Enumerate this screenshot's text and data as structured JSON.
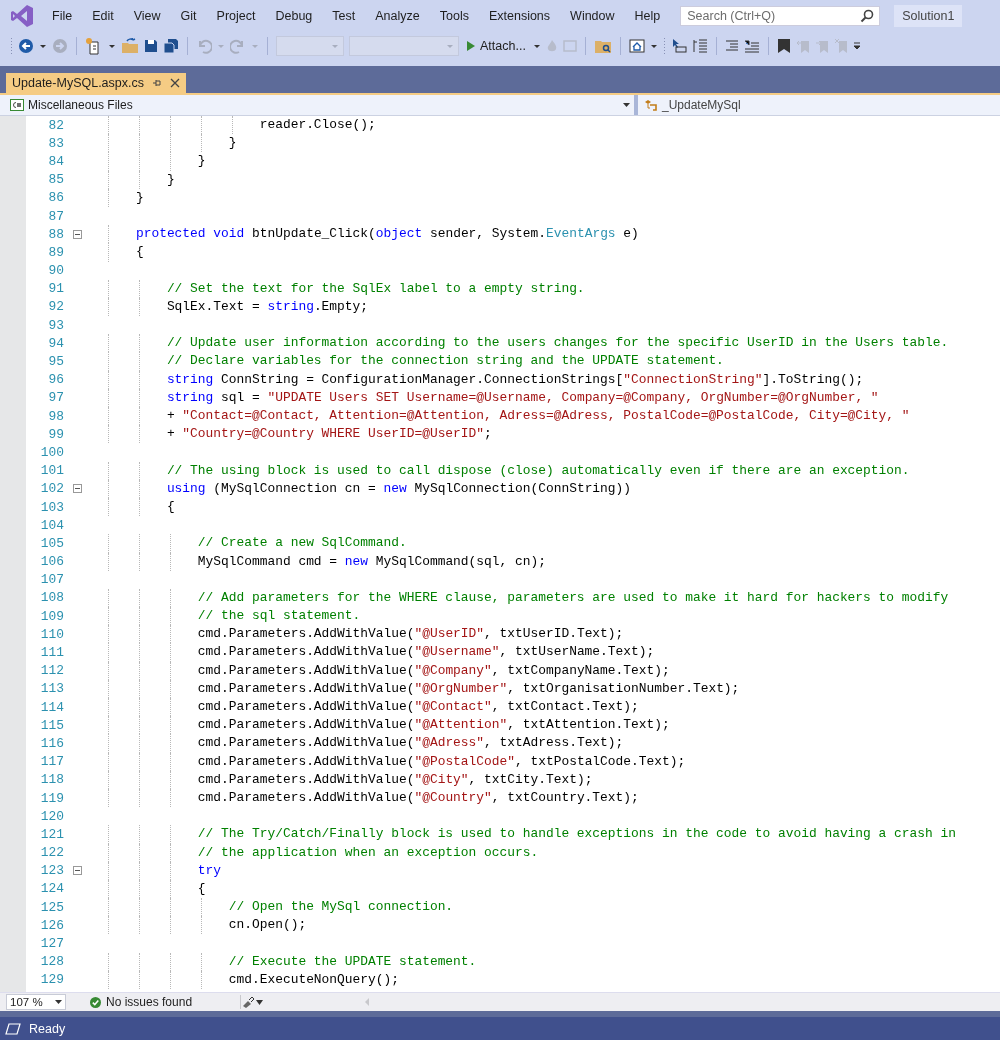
{
  "menu": {
    "items": [
      "File",
      "Edit",
      "View",
      "Git",
      "Project",
      "Debug",
      "Test",
      "Analyze",
      "Tools",
      "Extensions",
      "Window",
      "Help"
    ],
    "search": {
      "placeholder": "Search (Ctrl+Q)"
    },
    "solution": "Solution1"
  },
  "toolbar": {
    "attach": "Attach..."
  },
  "tabs": [
    {
      "label": "Update-MySQL.aspx.cs",
      "selected": true
    }
  ],
  "navbar": {
    "project": "Miscellaneous Files",
    "member": "_UpdateMySql"
  },
  "code": {
    "lines": [
      {
        "number": "82",
        "tokens": [
          {
            "kind": "plain",
            "text": "                    reader.Close();"
          }
        ]
      },
      {
        "number": "83",
        "tokens": [
          {
            "kind": "plain",
            "text": "                }"
          }
        ]
      },
      {
        "number": "84",
        "tokens": [
          {
            "kind": "plain",
            "text": "            }"
          }
        ]
      },
      {
        "number": "85",
        "tokens": [
          {
            "kind": "plain",
            "text": "        }"
          }
        ]
      },
      {
        "number": "86",
        "tokens": [
          {
            "kind": "plain",
            "text": "    }"
          }
        ]
      },
      {
        "number": "87"
      },
      {
        "number": "88",
        "expanded": true,
        "tokens": [
          {
            "kind": "keyword",
            "text": "    protected"
          },
          {
            "kind": "keyword",
            "text": " void"
          },
          {
            "kind": "plain",
            "text": " btnUpdate_Click("
          },
          {
            "kind": "keyword",
            "text": "object"
          },
          {
            "kind": "plain",
            "text": " sender, System."
          },
          {
            "kind": "type",
            "text": "EventArgs"
          },
          {
            "kind": "plain",
            "text": " e)"
          }
        ]
      },
      {
        "number": "89",
        "tokens": [
          {
            "kind": "plain",
            "text": "    {"
          }
        ]
      },
      {
        "number": "90"
      },
      {
        "number": "91",
        "tokens": [
          {
            "kind": "comment",
            "text": "        // Set the text for the SqlEx label to a empty string."
          }
        ]
      },
      {
        "number": "92",
        "tokens": [
          {
            "kind": "plain",
            "text": "        SqlEx.Text = "
          },
          {
            "kind": "keyword",
            "text": "string"
          },
          {
            "kind": "plain",
            "text": ".Empty;"
          }
        ]
      },
      {
        "number": "93"
      },
      {
        "number": "94",
        "tokens": [
          {
            "kind": "comment",
            "text": "        // Update user information according to the users changes for the specific UserID in the Users table."
          }
        ]
      },
      {
        "number": "95",
        "tokens": [
          {
            "kind": "comment",
            "text": "        // Declare variables for the connection string and the UPDATE statement."
          }
        ]
      },
      {
        "number": "96",
        "tokens": [
          {
            "kind": "keyword",
            "text": "        string"
          },
          {
            "kind": "plain",
            "text": " ConnString = ConfigurationManager.ConnectionStrings["
          },
          {
            "kind": "string",
            "text": "\"ConnectionString\""
          },
          {
            "kind": "plain",
            "text": "].ToString();"
          }
        ]
      },
      {
        "number": "97",
        "tokens": [
          {
            "kind": "keyword",
            "text": "        string"
          },
          {
            "kind": "plain",
            "text": " sql = "
          },
          {
            "kind": "string",
            "text": "\"UPDATE Users SET Username=@Username, Company=@Company, OrgNumber=@OrgNumber, \""
          }
        ]
      },
      {
        "number": "98",
        "tokens": [
          {
            "kind": "plain",
            "text": "        + "
          },
          {
            "kind": "string",
            "text": "\"Contact=@Contact, Attention=@Attention, Adress=@Adress, PostalCode=@PostalCode, City=@City, \""
          }
        ]
      },
      {
        "number": "99",
        "tokens": [
          {
            "kind": "plain",
            "text": "        + "
          },
          {
            "kind": "string",
            "text": "\"Country=@Country WHERE UserID=@UserID\""
          },
          {
            "kind": "plain",
            "text": ";"
          }
        ]
      },
      {
        "number": "100"
      },
      {
        "number": "101",
        "tokens": [
          {
            "kind": "comment",
            "text": "        // The using block is used to call dispose (close) automatically even if there are an exception."
          }
        ]
      },
      {
        "number": "102",
        "expanded": true,
        "tokens": [
          {
            "kind": "keyword",
            "text": "        using"
          },
          {
            "kind": "plain",
            "text": " (MySqlConnection cn = "
          },
          {
            "kind": "keyword",
            "text": "new"
          },
          {
            "kind": "plain",
            "text": " MySqlConnection(ConnString))"
          }
        ]
      },
      {
        "number": "103",
        "tokens": [
          {
            "kind": "plain",
            "text": "        {"
          }
        ]
      },
      {
        "number": "104"
      },
      {
        "number": "105",
        "tokens": [
          {
            "kind": "comment",
            "text": "            // Create a new SqlCommand."
          }
        ]
      },
      {
        "number": "106",
        "tokens": [
          {
            "kind": "plain",
            "text": "            MySqlCommand cmd = "
          },
          {
            "kind": "keyword",
            "text": "new"
          },
          {
            "kind": "plain",
            "text": " MySqlCommand(sql, cn);"
          }
        ]
      },
      {
        "number": "107"
      },
      {
        "number": "108",
        "tokens": [
          {
            "kind": "comment",
            "text": "            // Add parameters for the WHERE clause, parameters are used to make it hard for hackers to modify"
          }
        ]
      },
      {
        "number": "109",
        "tokens": [
          {
            "kind": "comment",
            "text": "            // the sql statement."
          }
        ]
      },
      {
        "number": "110",
        "tokens": [
          {
            "kind": "plain",
            "text": "            cmd.Parameters.AddWithValue("
          },
          {
            "kind": "string",
            "text": "\"@UserID\""
          },
          {
            "kind": "plain",
            "text": ", txtUserID.Text);"
          }
        ]
      },
      {
        "number": "111",
        "tokens": [
          {
            "kind": "plain",
            "text": "            cmd.Parameters.AddWithValue("
          },
          {
            "kind": "string",
            "text": "\"@Username\""
          },
          {
            "kind": "plain",
            "text": ", txtUserName.Text);"
          }
        ]
      },
      {
        "number": "112",
        "tokens": [
          {
            "kind": "plain",
            "text": "            cmd.Parameters.AddWithValue("
          },
          {
            "kind": "string",
            "text": "\"@Company\""
          },
          {
            "kind": "plain",
            "text": ", txtCompanyName.Text);"
          }
        ]
      },
      {
        "number": "113",
        "tokens": [
          {
            "kind": "plain",
            "text": "            cmd.Parameters.AddWithValue("
          },
          {
            "kind": "string",
            "text": "\"@OrgNumber\""
          },
          {
            "kind": "plain",
            "text": ", txtOrganisationNumber.Text);"
          }
        ]
      },
      {
        "number": "114",
        "tokens": [
          {
            "kind": "plain",
            "text": "            cmd.Parameters.AddWithValue("
          },
          {
            "kind": "string",
            "text": "\"@Contact\""
          },
          {
            "kind": "plain",
            "text": ", txtContact.Text);"
          }
        ]
      },
      {
        "number": "115",
        "tokens": [
          {
            "kind": "plain",
            "text": "            cmd.Parameters.AddWithValue("
          },
          {
            "kind": "string",
            "text": "\"@Attention\""
          },
          {
            "kind": "plain",
            "text": ", txtAttention.Text);"
          }
        ]
      },
      {
        "number": "116",
        "tokens": [
          {
            "kind": "plain",
            "text": "            cmd.Parameters.AddWithValue("
          },
          {
            "kind": "string",
            "text": "\"@Adress\""
          },
          {
            "kind": "plain",
            "text": ", txtAdress.Text);"
          }
        ]
      },
      {
        "number": "117",
        "tokens": [
          {
            "kind": "plain",
            "text": "            cmd.Parameters.AddWithValue("
          },
          {
            "kind": "string",
            "text": "\"@PostalCode\""
          },
          {
            "kind": "plain",
            "text": ", txtPostalCode.Text);"
          }
        ]
      },
      {
        "number": "118",
        "tokens": [
          {
            "kind": "plain",
            "text": "            cmd.Parameters.AddWithValue("
          },
          {
            "kind": "string",
            "text": "\"@City\""
          },
          {
            "kind": "plain",
            "text": ", txtCity.Text);"
          }
        ]
      },
      {
        "number": "119",
        "tokens": [
          {
            "kind": "plain",
            "text": "            cmd.Parameters.AddWithValue("
          },
          {
            "kind": "string",
            "text": "\"@Country\""
          },
          {
            "kind": "plain",
            "text": ", txtCountry.Text);"
          }
        ]
      },
      {
        "number": "120"
      },
      {
        "number": "121",
        "tokens": [
          {
            "kind": "comment",
            "text": "            // The Try/Catch/Finally block is used to handle exceptions in the code to avoid having a crash in"
          }
        ]
      },
      {
        "number": "122",
        "tokens": [
          {
            "kind": "comment",
            "text": "            // the application when an exception occurs."
          }
        ]
      },
      {
        "number": "123",
        "expanded": true,
        "tokens": [
          {
            "kind": "keyword",
            "text": "            try"
          }
        ]
      },
      {
        "number": "124",
        "tokens": [
          {
            "kind": "plain",
            "text": "            {"
          }
        ]
      },
      {
        "number": "125",
        "tokens": [
          {
            "kind": "comment",
            "text": "                // Open the MySql connection."
          }
        ]
      },
      {
        "number": "126",
        "tokens": [
          {
            "kind": "plain",
            "text": "                cn.Open();"
          }
        ]
      },
      {
        "number": "127"
      },
      {
        "number": "128",
        "tokens": [
          {
            "kind": "comment",
            "text": "                // Execute the UPDATE statement."
          }
        ]
      },
      {
        "number": "129",
        "tokens": [
          {
            "kind": "plain",
            "text": "                cmd.ExecuteNonQuery();"
          }
        ]
      }
    ]
  },
  "editor_status": {
    "zoom": "107 %",
    "issues": "No issues found"
  },
  "status_bar": {
    "text": "Ready"
  }
}
